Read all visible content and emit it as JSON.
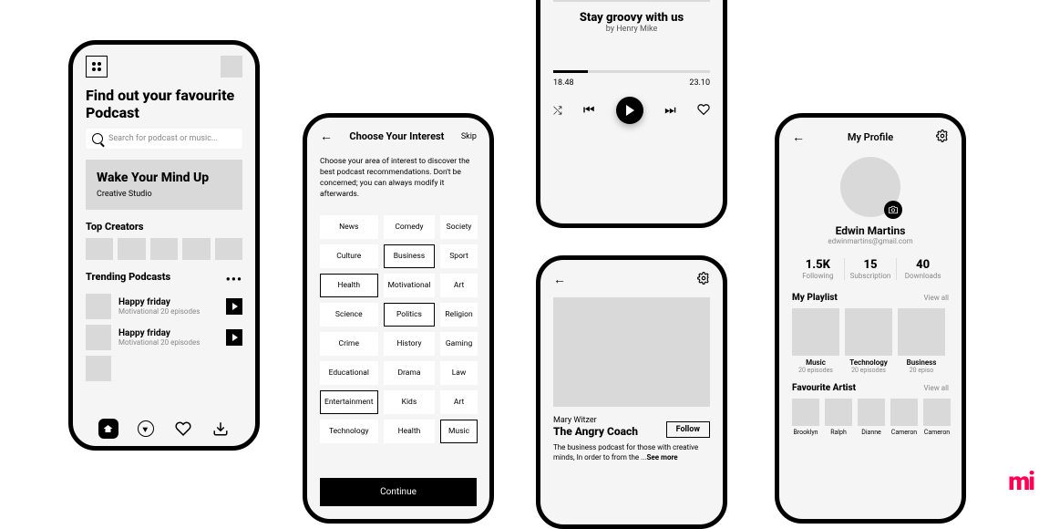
{
  "screen1": {
    "title": "Find out your favourite Podcast",
    "search_placeholder": "Search for podcast or music...",
    "hero": {
      "title": "Wake Your Mind Up",
      "subtitle": "Creative Studio"
    },
    "top_creators_label": "Top Creators",
    "trending_label": "Trending Podcasts",
    "trending": [
      {
        "title": "Happy friday",
        "meta": "Motivational    20 episodes"
      },
      {
        "title": "Happy friday",
        "meta": "Motivational    20 episodes"
      }
    ]
  },
  "screen2": {
    "title": "Choose Your Interest",
    "skip": "Skip",
    "desc": "Choose your area of interest to discover the best podcast recommendations. Don't be concerned; you can always modify it afterwards.",
    "chips": [
      {
        "l": "News",
        "s": false
      },
      {
        "l": "Comedy",
        "s": false
      },
      {
        "l": "Society",
        "s": false
      },
      {
        "l": "Culture",
        "s": false
      },
      {
        "l": "Business",
        "s": true
      },
      {
        "l": "Sport",
        "s": false
      },
      {
        "l": "Health",
        "s": true
      },
      {
        "l": "Motivational",
        "s": false
      },
      {
        "l": "Art",
        "s": false
      },
      {
        "l": "Science",
        "s": false
      },
      {
        "l": "Politics",
        "s": true
      },
      {
        "l": "Religion",
        "s": false
      },
      {
        "l": "Crime",
        "s": false
      },
      {
        "l": "History",
        "s": false
      },
      {
        "l": "Gaming",
        "s": false
      },
      {
        "l": "Educational",
        "s": false
      },
      {
        "l": "Drama",
        "s": false
      },
      {
        "l": "Law",
        "s": false
      },
      {
        "l": "Entertainment",
        "s": true
      },
      {
        "l": "Kids",
        "s": false
      },
      {
        "l": "Art",
        "s": false
      },
      {
        "l": "Technology",
        "s": false
      },
      {
        "l": "Health",
        "s": false
      },
      {
        "l": "Music",
        "s": true
      }
    ],
    "continue": "Continue"
  },
  "screen3": {
    "title": "Stay groovy with us",
    "author": "by Henry Mike",
    "current": "18.48",
    "total": "23.10"
  },
  "screen4": {
    "author": "Mary Witzer",
    "title": "The Angry Coach",
    "follow": "Follow",
    "desc": "The business podcast for those with creative minds, In order to from the ...",
    "see_more": "See more"
  },
  "screen5": {
    "header": "My Profile",
    "name": "Edwin Martins",
    "email": "edwinmartins@gmail.com",
    "stats": [
      {
        "v": "1.5K",
        "l": "Following"
      },
      {
        "v": "15",
        "l": "Subscription"
      },
      {
        "v": "40",
        "l": "Downloads"
      }
    ],
    "playlist_label": "My Playlist",
    "view_all": "View all",
    "playlist": [
      {
        "t": "Music",
        "s": "20 episodes"
      },
      {
        "t": "Technology",
        "s": "20 episodes"
      },
      {
        "t": "Business",
        "s": "20 episo"
      }
    ],
    "fav_label": "Favourite Artist",
    "artists": [
      "Brooklyn",
      "Ralph",
      "Dianne",
      "Cameron",
      "Cameron"
    ]
  },
  "logo": "mi"
}
